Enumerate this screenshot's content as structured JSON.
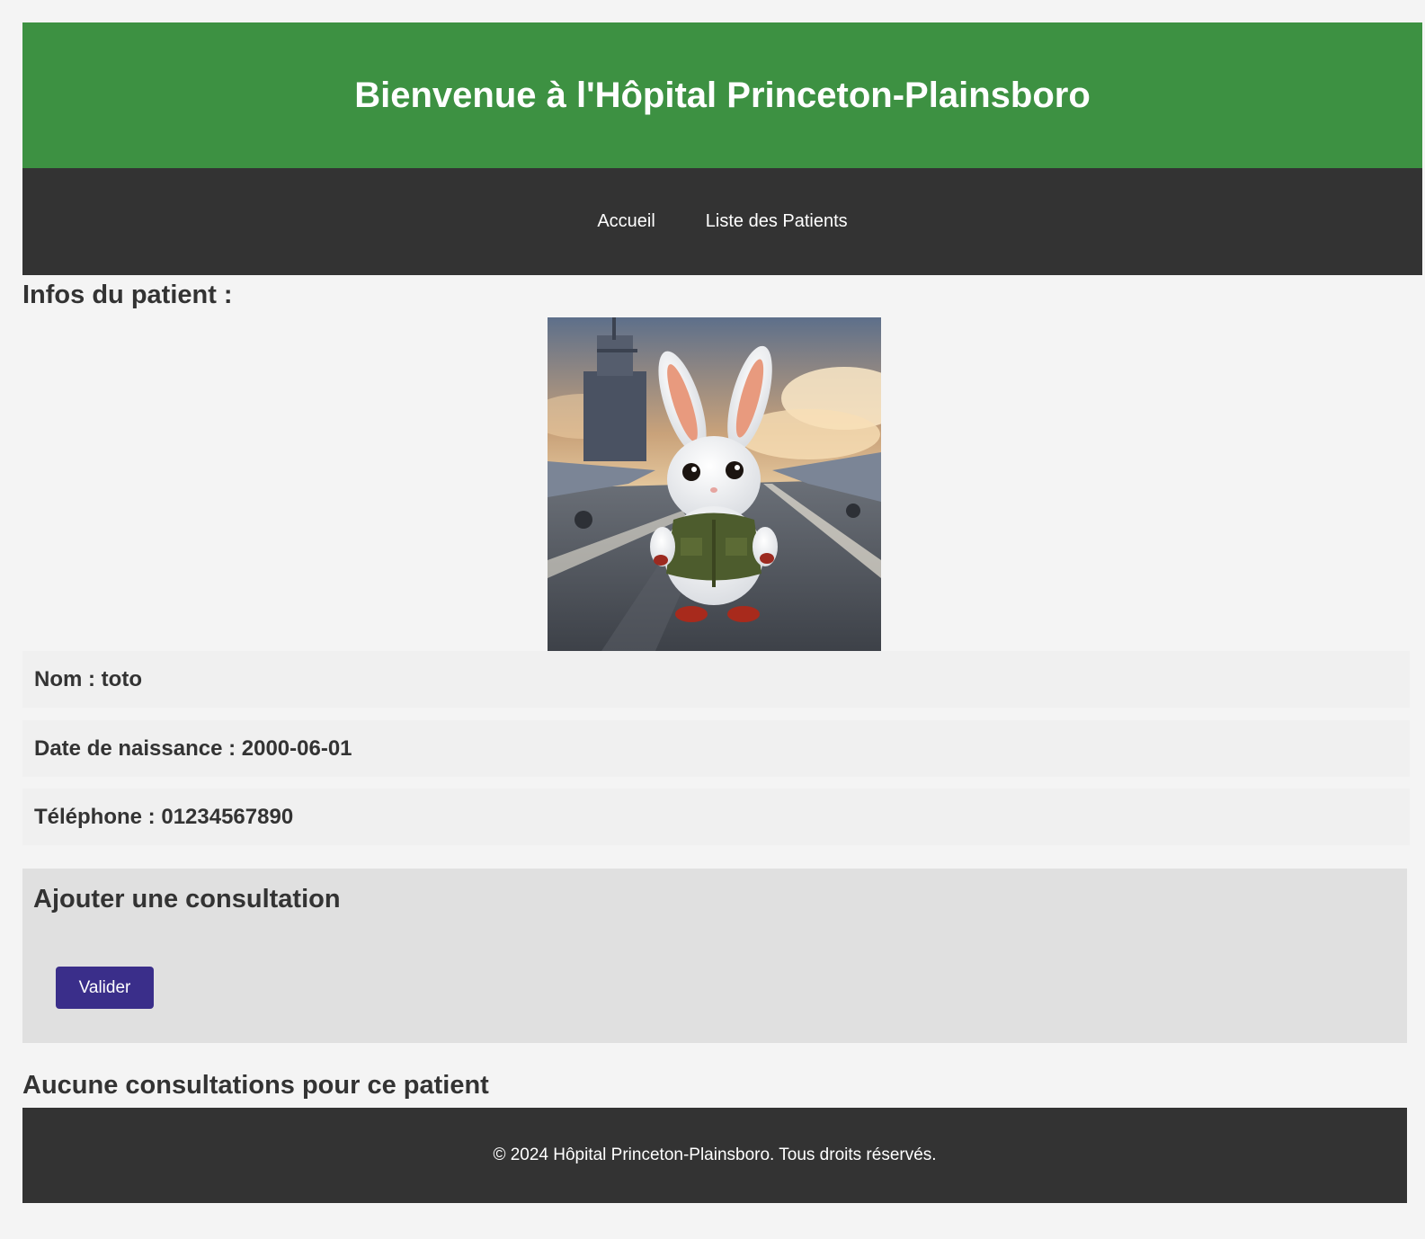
{
  "header": {
    "title": "Bienvenue à l'Hôpital Princeton-Plainsboro"
  },
  "nav": {
    "items": [
      {
        "label": "Accueil"
      },
      {
        "label": "Liste des Patients"
      }
    ]
  },
  "patient": {
    "section_title": "Infos du patient :",
    "photo_alt": "Photo du patient",
    "fields": [
      {
        "label": "Nom",
        "value": "toto"
      },
      {
        "label": "Date de naissance",
        "value": "2000-06-01"
      },
      {
        "label": "Téléphone",
        "value": "01234567890"
      }
    ]
  },
  "consultation_form": {
    "title": "Ajouter une consultation",
    "submit_label": "Valider"
  },
  "consultations": {
    "empty_message": "Aucune consultations pour ce patient"
  },
  "footer": {
    "text": "© 2024 Hôpital Princeton-Plainsboro. Tous droits réservés."
  },
  "colors": {
    "header_bg": "#3d9142",
    "nav_bg": "#333333",
    "button_bg": "#3a2e8a",
    "page_bg": "#f4f4f4"
  }
}
